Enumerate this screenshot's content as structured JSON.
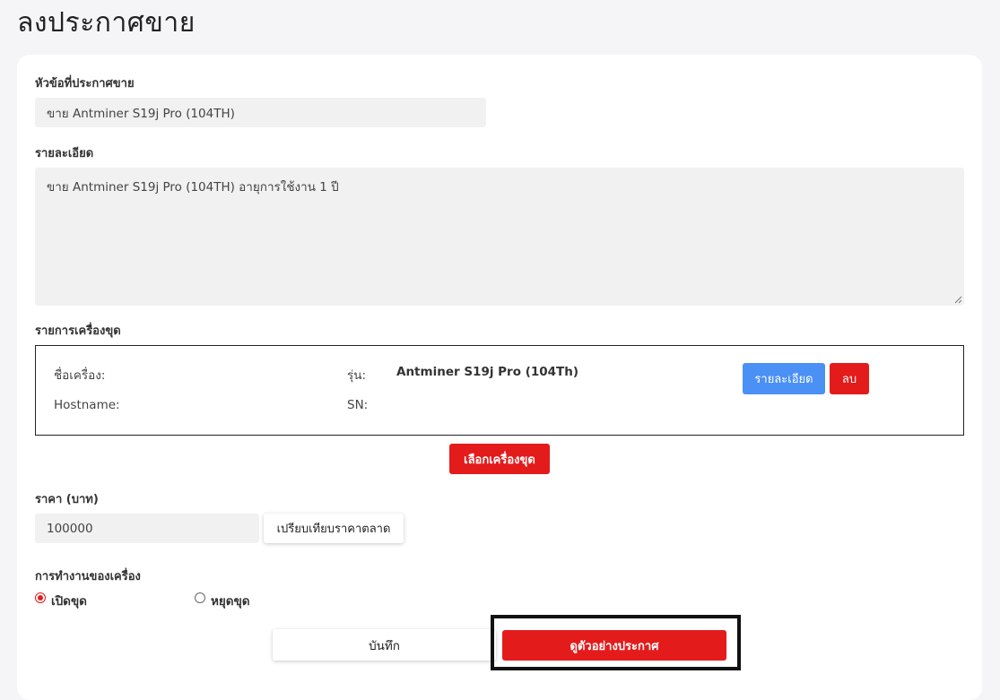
{
  "page": {
    "title": "ลงประกาศขาย"
  },
  "form": {
    "listing_title_label": "หัวข้อที่ประกาศขาย",
    "listing_title_value": "ขาย Antminer S19j Pro (104TH)",
    "details_label": "รายละเอียด",
    "details_value": "ขาย Antminer S19j Pro (104TH) อายุการใช้งาน 1 ปี",
    "miners_label": "รายการเครื่องขุด",
    "miner": {
      "name_label": "ชื่อเครื่อง:",
      "name_value": "",
      "model_label": "รุ่น:",
      "model_value": "Antminer S19j Pro (104Th)",
      "hostname_label": "Hostname:",
      "hostname_value": "",
      "sn_label": "SN:",
      "sn_value": "",
      "details_button": "รายละเอียด",
      "delete_button": "ลบ"
    },
    "select_miner_button": "เลือกเครื่องขุด",
    "price_label": "ราคา (บาท)",
    "price_value": "100000",
    "compare_price_button": "เปรียบเทียบราคาตลาด",
    "operation_label": "การทำงานของเครื่อง",
    "operation_options": [
      {
        "label": "เปิดขุด",
        "selected": true
      },
      {
        "label": "หยุดขุด",
        "selected": false
      }
    ],
    "save_button": "บันทึก",
    "preview_button": "ดูตัวอย่างประกาศ"
  },
  "colors": {
    "accent_red": "#e41b1b",
    "accent_blue": "#4a90f5",
    "field_bg": "#f1f1f1",
    "page_bg": "#f5f5f7"
  }
}
